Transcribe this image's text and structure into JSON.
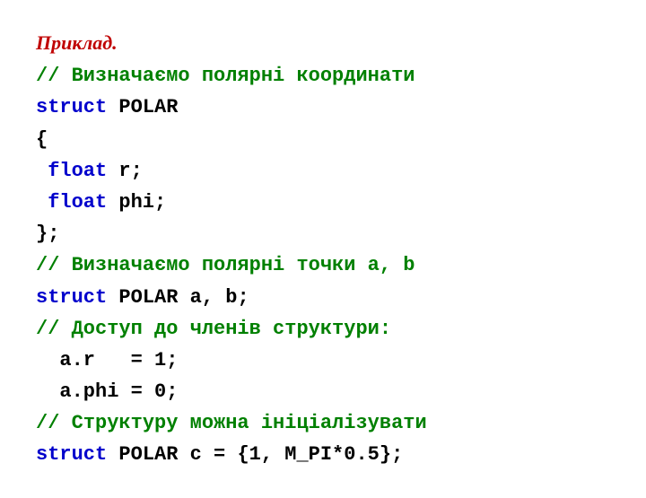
{
  "header": "Приклад.",
  "l1_comment": "// Визначаємо полярні координати",
  "l2_kw": "struct",
  "l2_code": " POLAR",
  "l3_code": "{",
  "l4_kw": "float",
  "l4_code": " r;",
  "l5_kw": "float",
  "l5_code": " phi;",
  "l6_code": "};",
  "l7_comment": "// Визначаємо полярні точки a, b",
  "l8_kw": "struct",
  "l8_code": " POLAR a, b;",
  "l9_comment": "// Доступ до членів структури:",
  "l10_code": "a.r   = 1;",
  "l11_code": "a.phi = 0;",
  "l12_comment": "// Структуру можна ініціалізувати",
  "l13_kw": "struct",
  "l13_code": " POLAR c = {1, M_PI*0.5};"
}
